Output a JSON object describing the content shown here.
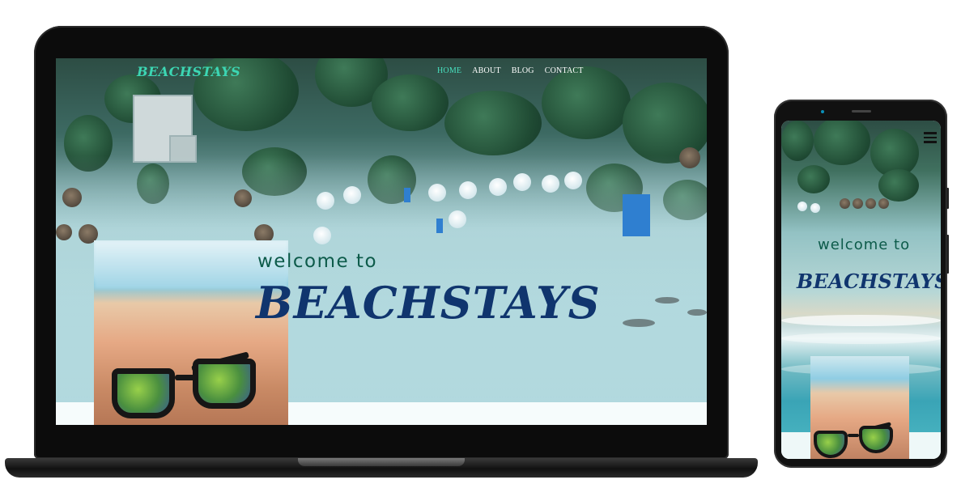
{
  "site": {
    "logo": "BEACHSTAYS",
    "nav": [
      {
        "label": "HOME",
        "active": true
      },
      {
        "label": "ABOUT",
        "active": false
      },
      {
        "label": "BLOG",
        "active": false
      },
      {
        "label": "CONTACT",
        "active": false
      }
    ],
    "hero": {
      "welcome": "welcome to",
      "title": "BEACHSTAYS"
    }
  },
  "mobile": {
    "menu_icon": "hamburger-menu-icon",
    "hero": {
      "welcome": "welcome to",
      "title": "BEACHSTAYS"
    }
  },
  "colors": {
    "logo": "#3cd6b3",
    "nav_active": "#48e0bf",
    "welcome_text": "#0d5b4a",
    "title_text": "#10356e"
  }
}
